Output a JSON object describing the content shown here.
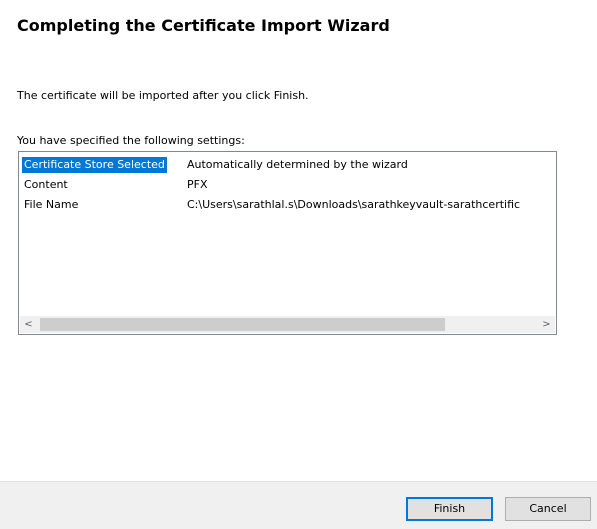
{
  "wizard": {
    "title": "Completing the Certificate Import Wizard",
    "info_text": "The certificate will be imported after you click Finish.",
    "settings_label": "You have specified the following settings:"
  },
  "settings": {
    "rows": [
      {
        "field": "Certificate Store Selected",
        "value": "Automatically determined by the wizard",
        "selected": true
      },
      {
        "field": "Content",
        "value": "PFX",
        "selected": false
      },
      {
        "field": "File Name",
        "value": "C:\\Users\\sarathlal.s\\Downloads\\sarathkeyvault-sarathcertific",
        "selected": false
      }
    ]
  },
  "scrollbar": {
    "left_icon": "chevron-left-icon",
    "right_icon": "chevron-right-icon",
    "left_glyph": "<",
    "right_glyph": ">"
  },
  "buttons": {
    "finish_label": "Finish",
    "cancel_label": "Cancel"
  },
  "colors": {
    "selection": "#0078d7",
    "footer": "#f0f0f0"
  }
}
